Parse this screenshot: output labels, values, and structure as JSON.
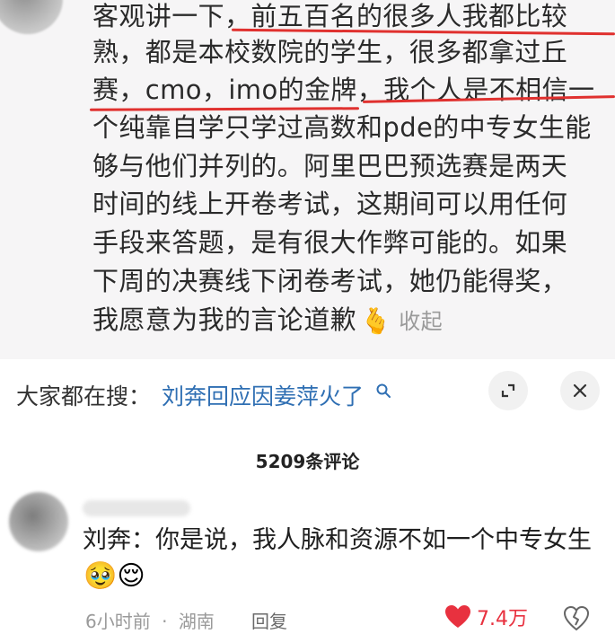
{
  "top_comment": {
    "lines": [
      "客观讲一下，前五百名的很多人我都比较",
      "熟，都是本校数院的学生，很多都拿过丘",
      "赛，cmo，imo的金牌，我个人是不相信一",
      "个纯靠自学只学过高数和pde的中专女生能",
      "够与他们并列的。阿里巴巴预选赛是两天",
      "时间的线上开卷考试，这期间可以用任何",
      "手段来答题，是有很大作弊可能的。如果",
      "下周的决赛线下闭卷考试，她仍能得奖，",
      "我愿意为我的言论道歉"
    ],
    "emoji": "🫰",
    "collapse_label": "收起"
  },
  "search_bar": {
    "prefix": "大家都在搜：",
    "query": "刘奔回应因姜萍火了"
  },
  "comments_header": {
    "count_label": "5209条评论"
  },
  "comment": {
    "text": "刘奔：你是说，我人脉和资源不如一个中专女生",
    "emojis": "🥹😌",
    "time": "6小时前",
    "location": "湖南",
    "separator": "·",
    "reply_label": "回复",
    "like_count": "7.4万"
  },
  "colors": {
    "underline": "#e0312f",
    "link": "#2f6fb3",
    "like": "#e8313f"
  }
}
